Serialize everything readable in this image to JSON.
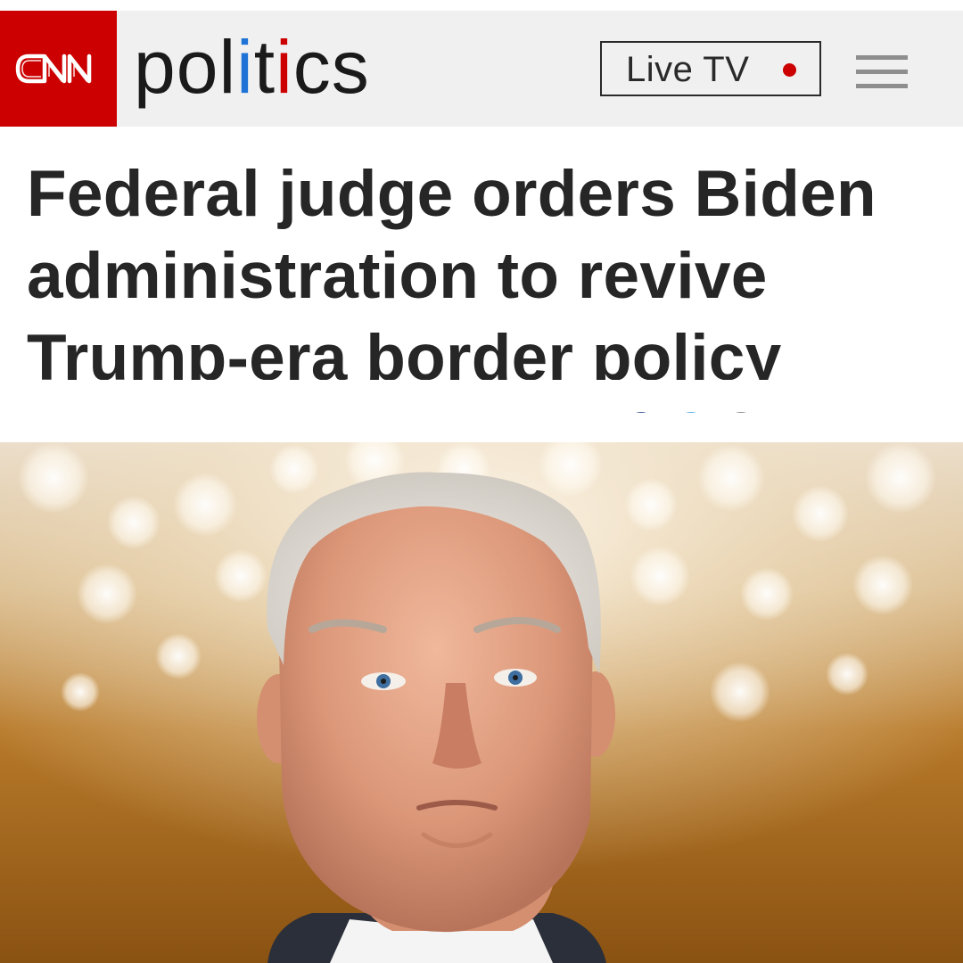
{
  "header": {
    "brand_logo_text": "CNN",
    "section_letters": [
      "p",
      "o",
      "l",
      "i",
      "t",
      "i",
      "c",
      "s"
    ],
    "live_label": "Live TV",
    "brand_color": "#cc0000",
    "live_dot_color": "#cc0000",
    "menu_icon": "hamburger-menu-icon"
  },
  "article": {
    "headline": "Federal judge orders Biden administration to revive Trump-era border policy",
    "share_icons": [
      "facebook-icon",
      "twitter-icon",
      "email-icon"
    ]
  }
}
